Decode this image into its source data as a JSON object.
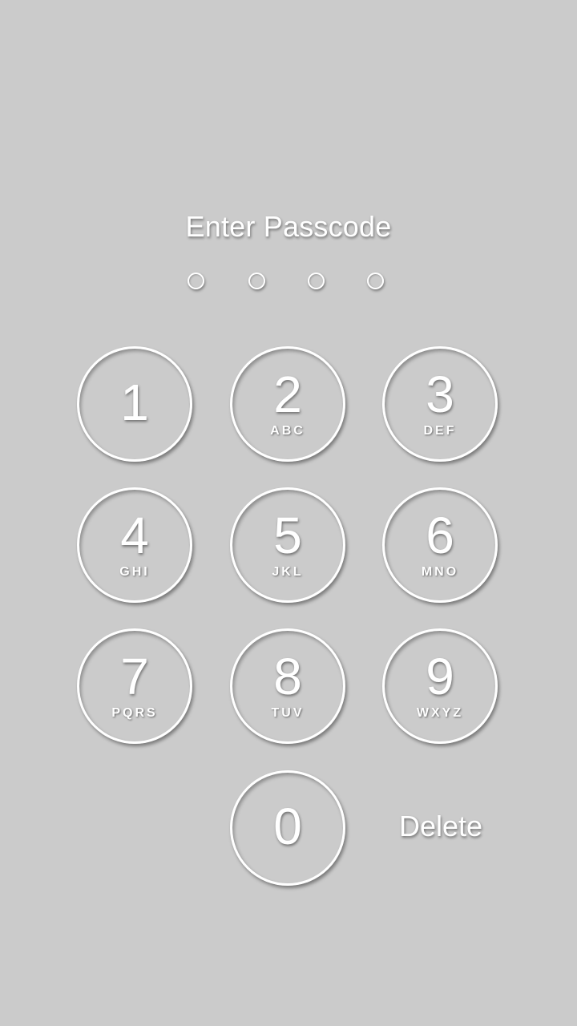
{
  "screen": {
    "title": "Enter Passcode",
    "delete_label": "Delete",
    "passcode_length": 4,
    "entered_digits": 0
  },
  "keypad": {
    "k1": {
      "digit": "1",
      "letters": ""
    },
    "k2": {
      "digit": "2",
      "letters": "ABC"
    },
    "k3": {
      "digit": "3",
      "letters": "DEF"
    },
    "k4": {
      "digit": "4",
      "letters": "GHI"
    },
    "k5": {
      "digit": "5",
      "letters": "JKL"
    },
    "k6": {
      "digit": "6",
      "letters": "MNO"
    },
    "k7": {
      "digit": "7",
      "letters": "PQRS"
    },
    "k8": {
      "digit": "8",
      "letters": "TUV"
    },
    "k9": {
      "digit": "9",
      "letters": "WXYZ"
    },
    "k0": {
      "digit": "0",
      "letters": ""
    }
  },
  "colors": {
    "background": "#cbcbcb",
    "foreground": "#ffffff"
  }
}
